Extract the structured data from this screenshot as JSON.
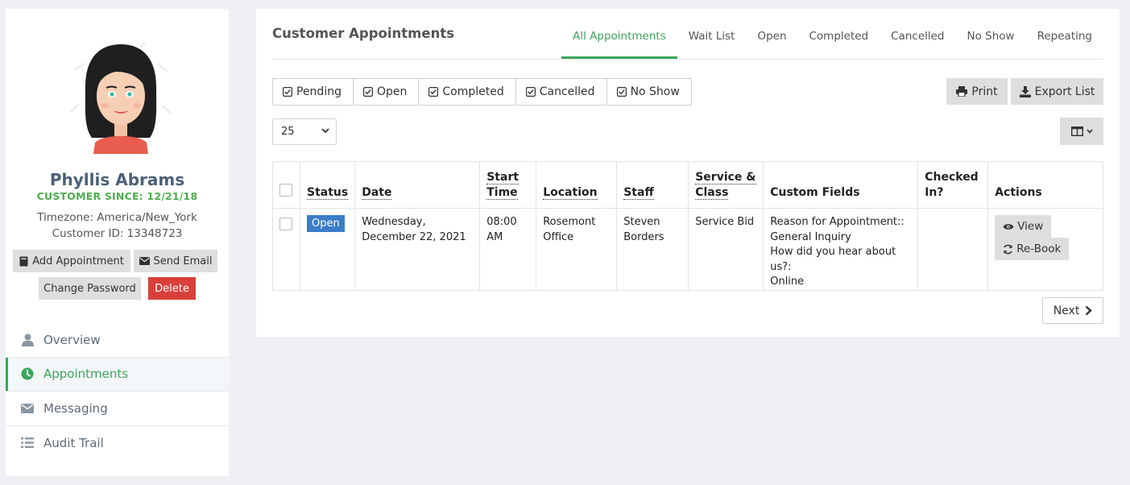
{
  "customer": {
    "name": "Phyllis Abrams",
    "since": "CUSTOMER SINCE: 12/21/18",
    "timezone": "Timezone: America/New_York",
    "customer_id": "Customer ID: 13348723"
  },
  "profile_actions": {
    "add_appointment": "Add Appointment",
    "send_email": "Send Email",
    "change_password": "Change Password",
    "delete": "Delete"
  },
  "nav": {
    "items": [
      {
        "label": "Overview",
        "icon": "user-icon",
        "active": false
      },
      {
        "label": "Appointments",
        "icon": "clock-icon",
        "active": true
      },
      {
        "label": "Messaging",
        "icon": "envelope-icon",
        "active": false
      },
      {
        "label": "Audit Trail",
        "icon": "list-icon",
        "active": false
      }
    ]
  },
  "main": {
    "title": "Customer Appointments",
    "tabs": [
      {
        "label": "All Appointments",
        "active": true
      },
      {
        "label": "Wait List"
      },
      {
        "label": "Open"
      },
      {
        "label": "Completed"
      },
      {
        "label": "Cancelled"
      },
      {
        "label": "No Show"
      },
      {
        "label": "Repeating"
      }
    ],
    "filters": [
      "Pending",
      "Open",
      "Completed",
      "Cancelled",
      "No Show"
    ],
    "print_label": "Print",
    "export_label": "Export List",
    "page_size": "25",
    "next_label": "Next"
  },
  "table": {
    "headers": {
      "status": "Status",
      "date": "Date",
      "start_time_1": "Start",
      "start_time_2": "Time",
      "location": "Location",
      "staff": "Staff",
      "service_1": "Service &",
      "service_2": "Class",
      "custom_fields": "Custom Fields",
      "checked_in_1": "Checked",
      "checked_in_2": "In?",
      "actions": "Actions"
    },
    "rows": [
      {
        "status": "Open",
        "date_1": "Wednesday,",
        "date_2": "December 22, 2021",
        "time_1": "08:00",
        "time_2": "AM",
        "location_1": "Rosemont",
        "location_2": "Office",
        "staff_1": "Steven",
        "staff_2": "Borders",
        "service": "Service Bid",
        "custom_1": "Reason for Appointment::",
        "custom_2": "General Inquiry",
        "custom_3": "How did you hear about us?:",
        "custom_4": "Online",
        "checked_in": "",
        "view_label": "View",
        "rebook_label": "Re-Book"
      }
    ]
  },
  "colors": {
    "accent_green": "#3ba55c",
    "status_blue": "#3a7dc9",
    "danger_red": "#d9403a",
    "button_gray": "#dedede"
  }
}
